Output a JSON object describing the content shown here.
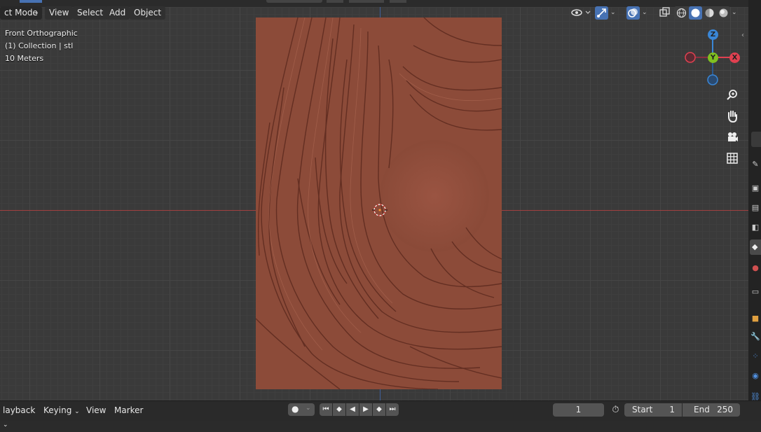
{
  "header": {
    "mode_label": "ct Mode",
    "menus": [
      "View",
      "Select",
      "Add",
      "Object"
    ]
  },
  "overlay": {
    "view_name": "Front Orthographic",
    "collection": "(1) Collection | stl",
    "scale": "10 Meters"
  },
  "gizmo": {
    "z": "Z",
    "y": "Y",
    "x": "X"
  },
  "timeline": {
    "playback": "layback",
    "keying": "Keying",
    "view": "View",
    "marker": "Marker",
    "current_frame": "1",
    "start_label": "Start",
    "start_value": "1",
    "end_label": "End",
    "end_value": "250"
  },
  "colors": {
    "relief": "#8a4a38",
    "x_axis": "#e04050",
    "y_axis": "#80c020",
    "z_axis": "#3a86d6"
  },
  "icons": [
    "visibility-icon",
    "gizmo-icon",
    "overlay-icon",
    "xray-icon",
    "wireframe-shading-icon",
    "solid-shading-icon",
    "material-shading-icon",
    "rendered-shading-icon",
    "zoom-icon",
    "pan-hand-icon",
    "camera-icon",
    "grid-icon"
  ]
}
